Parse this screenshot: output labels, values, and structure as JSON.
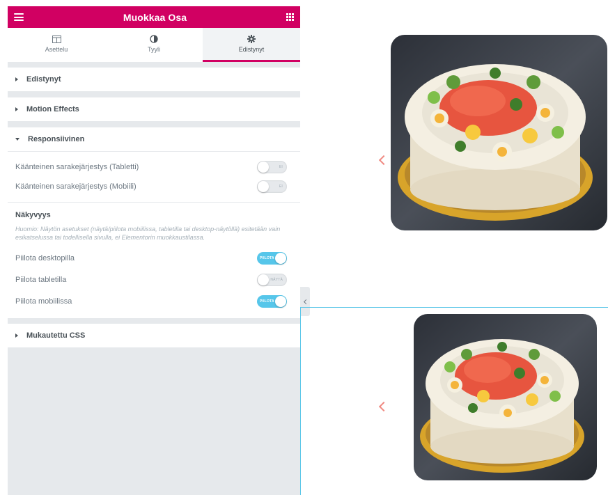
{
  "editor": {
    "title": "Muokkaa Osa",
    "tabs": [
      {
        "label": "Asettelu",
        "icon": "layout-icon"
      },
      {
        "label": "Tyyli",
        "icon": "half-circle-icon"
      },
      {
        "label": "Edistynyt",
        "icon": "gear-icon"
      }
    ],
    "active_tab": "Edistynyt",
    "accent_color": "#d10062"
  },
  "sections": {
    "advanced": "Edistynyt",
    "motion": "Motion Effects",
    "responsive": "Responsiivinen",
    "custom_css": "Mukautettu CSS"
  },
  "responsive": {
    "reverse_tablet": {
      "label": "Käänteinen sarakejärjestys (Tabletti)",
      "state": "off",
      "text": "EI"
    },
    "reverse_mobile": {
      "label": "Käänteinen sarakejärjestys (Mobiili)",
      "state": "off",
      "text": "EI"
    },
    "visibility_heading": "Näkyvyys",
    "visibility_note": "Huomio: Näytön asetukset (näytä/piilota mobiilissa, tabletilla tai desktop-näytöllä) esitetään vain esikatselussa tai todellisella sivulla, ei Elementorin muokkaustilassa.",
    "hide_desktop": {
      "label": "Piilota desktopilla",
      "state": "on",
      "text": "PIILOTA"
    },
    "hide_tablet": {
      "label": "Piilota tabletilla",
      "state": "off",
      "text": "NÄYTÄ"
    },
    "hide_mobile": {
      "label": "Piilota mobiilissa",
      "state": "on",
      "text": "PIILOTA"
    }
  },
  "preview": {
    "images": [
      "sandwich-cake-photo",
      "sandwich-cake-photo"
    ],
    "arrow_icon": "chevron-left-icon",
    "arrow_color": "#f08a82",
    "selection_line_color": "#59c6e8"
  }
}
